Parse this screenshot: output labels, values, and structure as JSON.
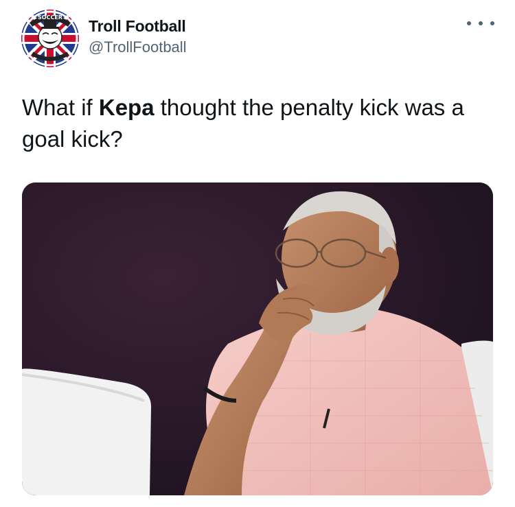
{
  "author": {
    "display_name": "Troll Football",
    "handle": "@TrollFootball",
    "avatar_icon": "troll-face-union-jack-avatar",
    "avatar_text": "SOCCER"
  },
  "menu": {
    "icon": "more-options-icon"
  },
  "tweet": {
    "text_before": "What if ",
    "text_bold": "Kepa",
    "text_after": " thought the penalty kick was a goal kick?"
  },
  "media": {
    "description_icon": "photo-man-thinking-hand-on-chin"
  },
  "colors": {
    "primary_text": "#0f1419",
    "secondary_text": "#536471",
    "photo_background": "#2a1a2a",
    "shirt": "#f2c3c0"
  }
}
